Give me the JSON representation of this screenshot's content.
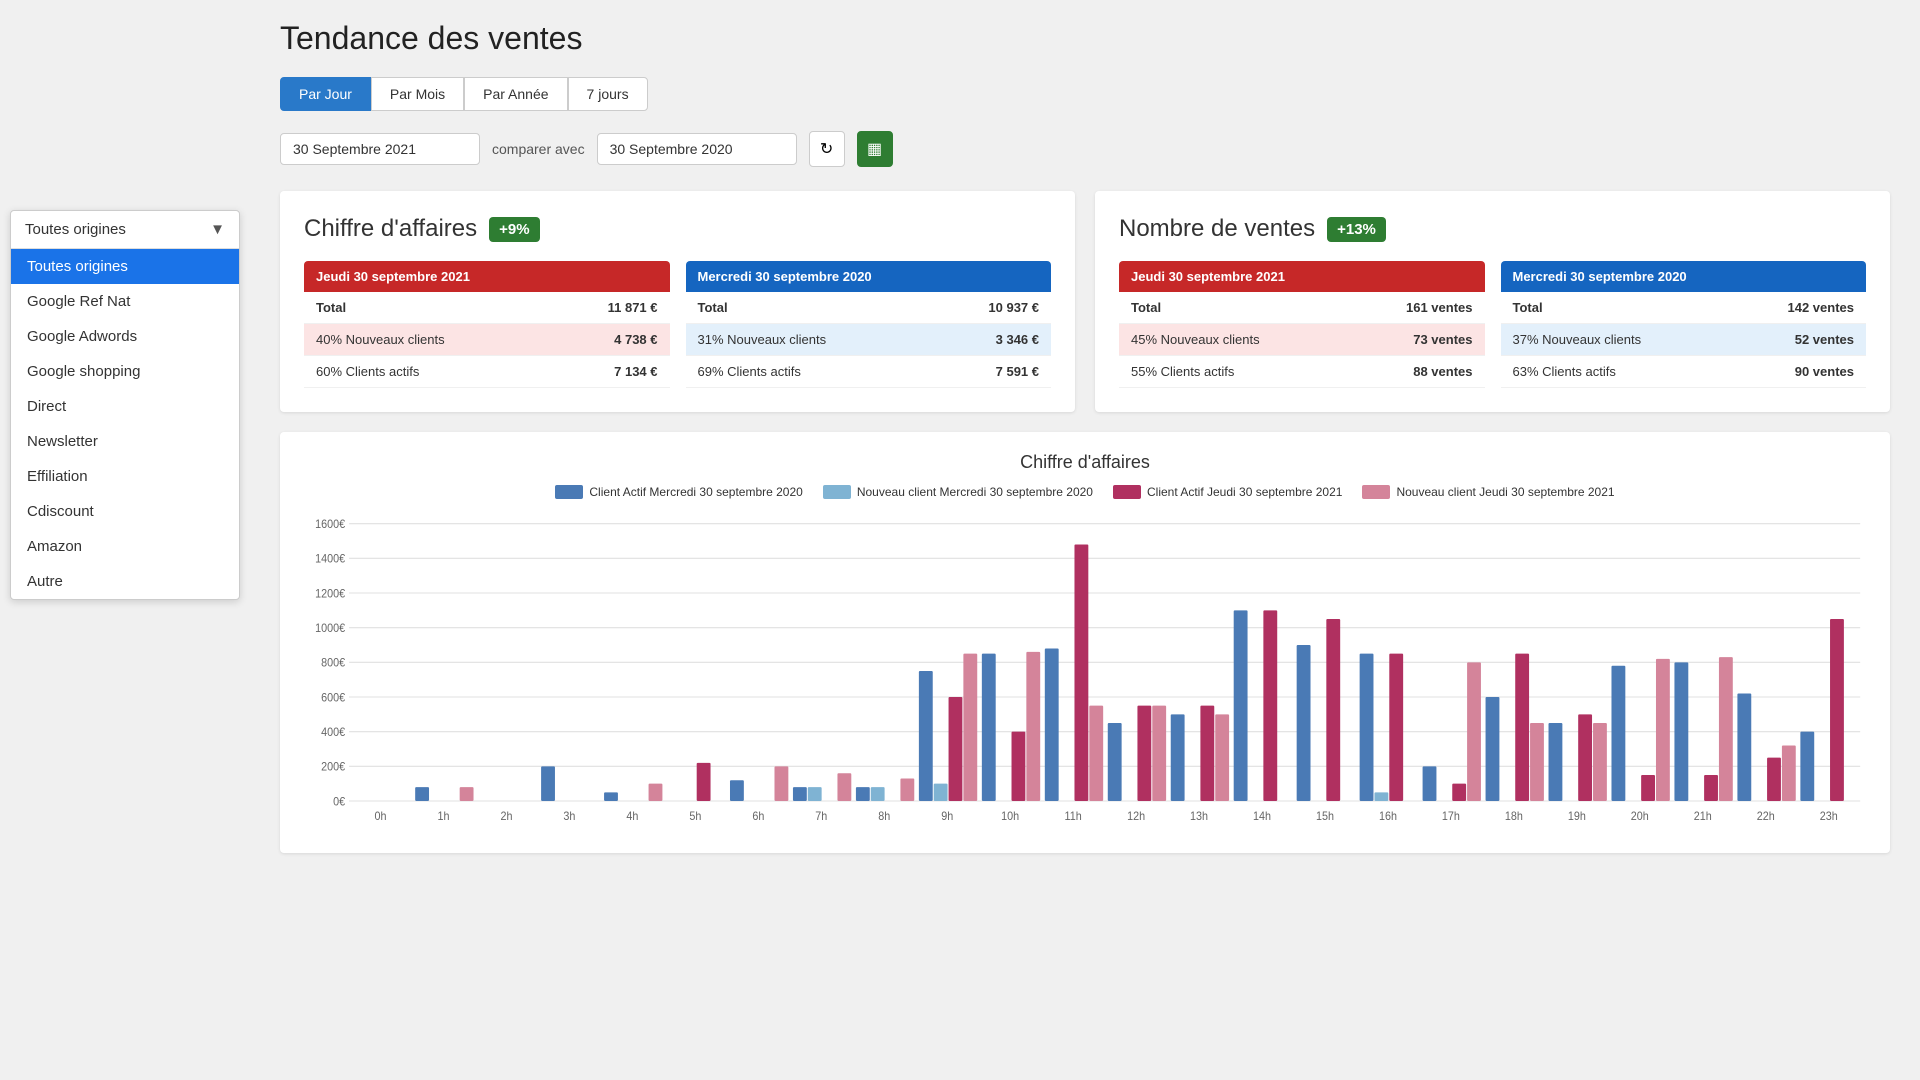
{
  "page": {
    "title": "Tendance des ventes"
  },
  "tabs": [
    {
      "id": "jour",
      "label": "Par Jour",
      "active": true
    },
    {
      "id": "mois",
      "label": "Par Mois",
      "active": false
    },
    {
      "id": "annee",
      "label": "Par Année",
      "active": false
    },
    {
      "id": "sept",
      "label": "7 jours",
      "active": false
    }
  ],
  "dateFilter": {
    "date1": "30 Septembre 2021",
    "comparerAvec": "comparer avec",
    "date2": "30 Septembre 2020"
  },
  "dropdown": {
    "label": "Toutes origines",
    "options": [
      {
        "label": "Toutes origines",
        "active": true
      },
      {
        "label": "Google Ref Nat",
        "active": false
      },
      {
        "label": "Google Adwords",
        "active": false
      },
      {
        "label": "Google shopping",
        "active": false
      },
      {
        "label": "Direct",
        "active": false
      },
      {
        "label": "Newsletter",
        "active": false
      },
      {
        "label": "Effiliation",
        "active": false
      },
      {
        "label": "Cdiscount",
        "active": false
      },
      {
        "label": "Amazon",
        "active": false
      },
      {
        "label": "Autre",
        "active": false
      }
    ]
  },
  "cardCA": {
    "title": "Chiffre d'affaires",
    "badge": "+9%",
    "col1": {
      "header": "Jeudi 30 septembre 2021",
      "total_label": "Total",
      "total_value": "11 871 €",
      "row1_label": "40% Nouveaux clients",
      "row1_value": "4 738 €",
      "row2_label": "60% Clients actifs",
      "row2_value": "7 134 €"
    },
    "col2": {
      "header": "Mercredi 30 septembre 2020",
      "total_label": "Total",
      "total_value": "10 937 €",
      "row1_label": "31% Nouveaux clients",
      "row1_value": "3 346 €",
      "row2_label": "69% Clients actifs",
      "row2_value": "7 591 €"
    }
  },
  "cardVentes": {
    "title": "Nombre de ventes",
    "badge": "+13%",
    "col1": {
      "header": "Jeudi 30 septembre 2021",
      "total_label": "Total",
      "total_value": "161 ventes",
      "row1_label": "45% Nouveaux clients",
      "row1_value": "73 ventes",
      "row2_label": "55% Clients actifs",
      "row2_value": "88 ventes"
    },
    "col2": {
      "header": "Mercredi 30 septembre 2020",
      "total_label": "Total",
      "total_value": "142 ventes",
      "row1_label": "37% Nouveaux clients",
      "row1_value": "52 ventes",
      "row2_label": "63% Clients actifs",
      "row2_value": "90 ventes"
    }
  },
  "chart": {
    "title": "Chiffre d'affaires",
    "legend": [
      {
        "label": "Client Actif Mercredi 30 septembre 2020",
        "color": "#4a7ab5"
      },
      {
        "label": "Nouveau client Mercredi 30 septembre 2020",
        "color": "#7fb3d3"
      },
      {
        "label": "Client Actif Jeudi 30 septembre 2021",
        "color": "#b03060"
      },
      {
        "label": "Nouveau client Jeudi 30 septembre 2021",
        "color": "#d4849a"
      }
    ],
    "xLabels": [
      "0h",
      "1h",
      "2h",
      "3h",
      "4h",
      "5h",
      "6h",
      "7h",
      "8h",
      "9h",
      "10h",
      "11h",
      "12h",
      "13h",
      "14h",
      "15h",
      "16h",
      "17h",
      "18h",
      "19h",
      "20h",
      "21h",
      "22h",
      "23h"
    ],
    "yMax": 1600,
    "yLabels": [
      "1600€",
      "1400€",
      "1200€",
      "1000€",
      "800€",
      "600€",
      "400€",
      "200€",
      "0€"
    ],
    "series": {
      "activeOld": [
        0,
        80,
        0,
        200,
        50,
        0,
        120,
        80,
        80,
        750,
        850,
        880,
        450,
        500,
        1100,
        900,
        850,
        200,
        600,
        450,
        780,
        800,
        620,
        400
      ],
      "newOld": [
        0,
        0,
        0,
        0,
        0,
        0,
        0,
        80,
        80,
        100,
        0,
        0,
        0,
        0,
        0,
        0,
        50,
        0,
        0,
        0,
        0,
        0,
        0,
        0
      ],
      "activeNew": [
        0,
        0,
        0,
        0,
        0,
        220,
        0,
        0,
        0,
        600,
        400,
        1480,
        550,
        550,
        1100,
        1050,
        850,
        100,
        850,
        500,
        150,
        150,
        250,
        1050
      ],
      "newNew": [
        0,
        80,
        0,
        0,
        100,
        0,
        200,
        160,
        130,
        850,
        860,
        550,
        550,
        500,
        0,
        0,
        0,
        800,
        450,
        450,
        820,
        830,
        320,
        0
      ]
    }
  }
}
